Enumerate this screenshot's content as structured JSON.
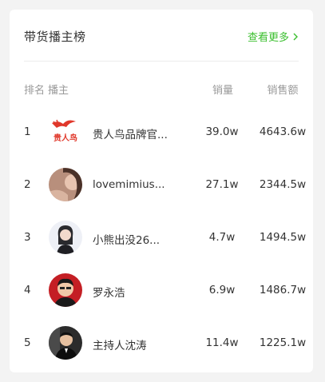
{
  "header": {
    "title": "带货播主榜",
    "more_label": "查看更多"
  },
  "columns": {
    "rank": "排名",
    "host": "播主",
    "sales": "销量",
    "amount": "销售额"
  },
  "rows": [
    {
      "rank": "1",
      "name": "贵人鸟品牌官...",
      "sales": "39.0w",
      "amount": "4643.6w",
      "logo_text": "贵人鸟"
    },
    {
      "rank": "2",
      "name": "lovemimius...",
      "sales": "27.1w",
      "amount": "2344.5w"
    },
    {
      "rank": "3",
      "name": "小熊出没26...",
      "sales": "4.7w",
      "amount": "1494.5w"
    },
    {
      "rank": "4",
      "name": "罗永浩",
      "sales": "6.9w",
      "amount": "1486.7w"
    },
    {
      "rank": "5",
      "name": "主持人沈涛",
      "sales": "11.4w",
      "amount": "1225.1w"
    }
  ],
  "colors": {
    "accent": "#3bbf2f",
    "brand_red": "#e0382b"
  }
}
